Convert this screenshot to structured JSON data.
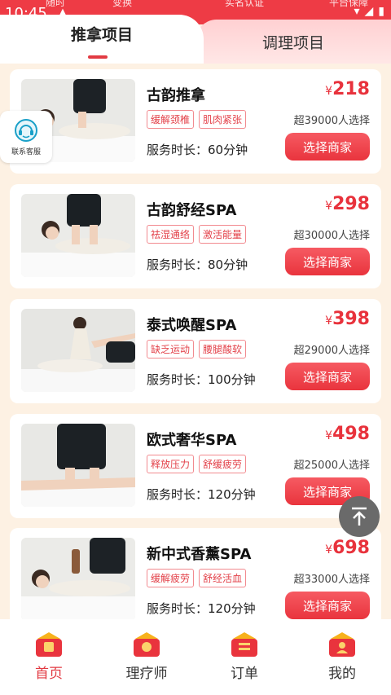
{
  "statusbar": {
    "time": "10:45",
    "ghost": [
      "随时",
      "变换",
      "实名认证",
      "平台保障"
    ]
  },
  "tabs": {
    "left": "推拿项目",
    "right": "调理项目"
  },
  "contact": {
    "label": "联系客服"
  },
  "items": [
    {
      "title": "古韵推拿",
      "tags": [
        "缓解颈椎",
        "肌肉紧张"
      ],
      "duration": "服务时长：60分钟",
      "currency": "¥",
      "price": "218",
      "sold": "超39000人选择",
      "button": "选择商家"
    },
    {
      "title": "古韵舒经SPA",
      "tags": [
        "祛湿通络",
        "激活能量"
      ],
      "duration": "服务时长：80分钟",
      "currency": "¥",
      "price": "298",
      "sold": "超30000人选择",
      "button": "选择商家"
    },
    {
      "title": "泰式唤醒SPA",
      "tags": [
        "缺乏运动",
        "腰腿酸软"
      ],
      "duration": "服务时长：100分钟",
      "currency": "¥",
      "price": "398",
      "sold": "超29000人选择",
      "button": "选择商家"
    },
    {
      "title": "欧式奢华SPA",
      "tags": [
        "释放压力",
        "舒缓疲劳"
      ],
      "duration": "服务时长：120分钟",
      "currency": "¥",
      "price": "498",
      "sold": "超25000人选择",
      "button": "选择商家"
    },
    {
      "title": "新中式香薰SPA",
      "tags": [
        "缓解疲劳",
        "舒经活血"
      ],
      "duration": "服务时长：120分钟",
      "currency": "¥",
      "price": "698",
      "sold": "超33000人选择",
      "button": "选择商家"
    }
  ],
  "tabbar": [
    {
      "label": "首页",
      "icon": "home-icon",
      "active": true
    },
    {
      "label": "理疗师",
      "icon": "therapist-icon",
      "active": false
    },
    {
      "label": "订单",
      "icon": "order-icon",
      "active": false
    },
    {
      "label": "我的",
      "icon": "profile-icon",
      "active": false
    }
  ],
  "colors": {
    "accent": "#e8323c",
    "background": "#fdf1e3"
  }
}
